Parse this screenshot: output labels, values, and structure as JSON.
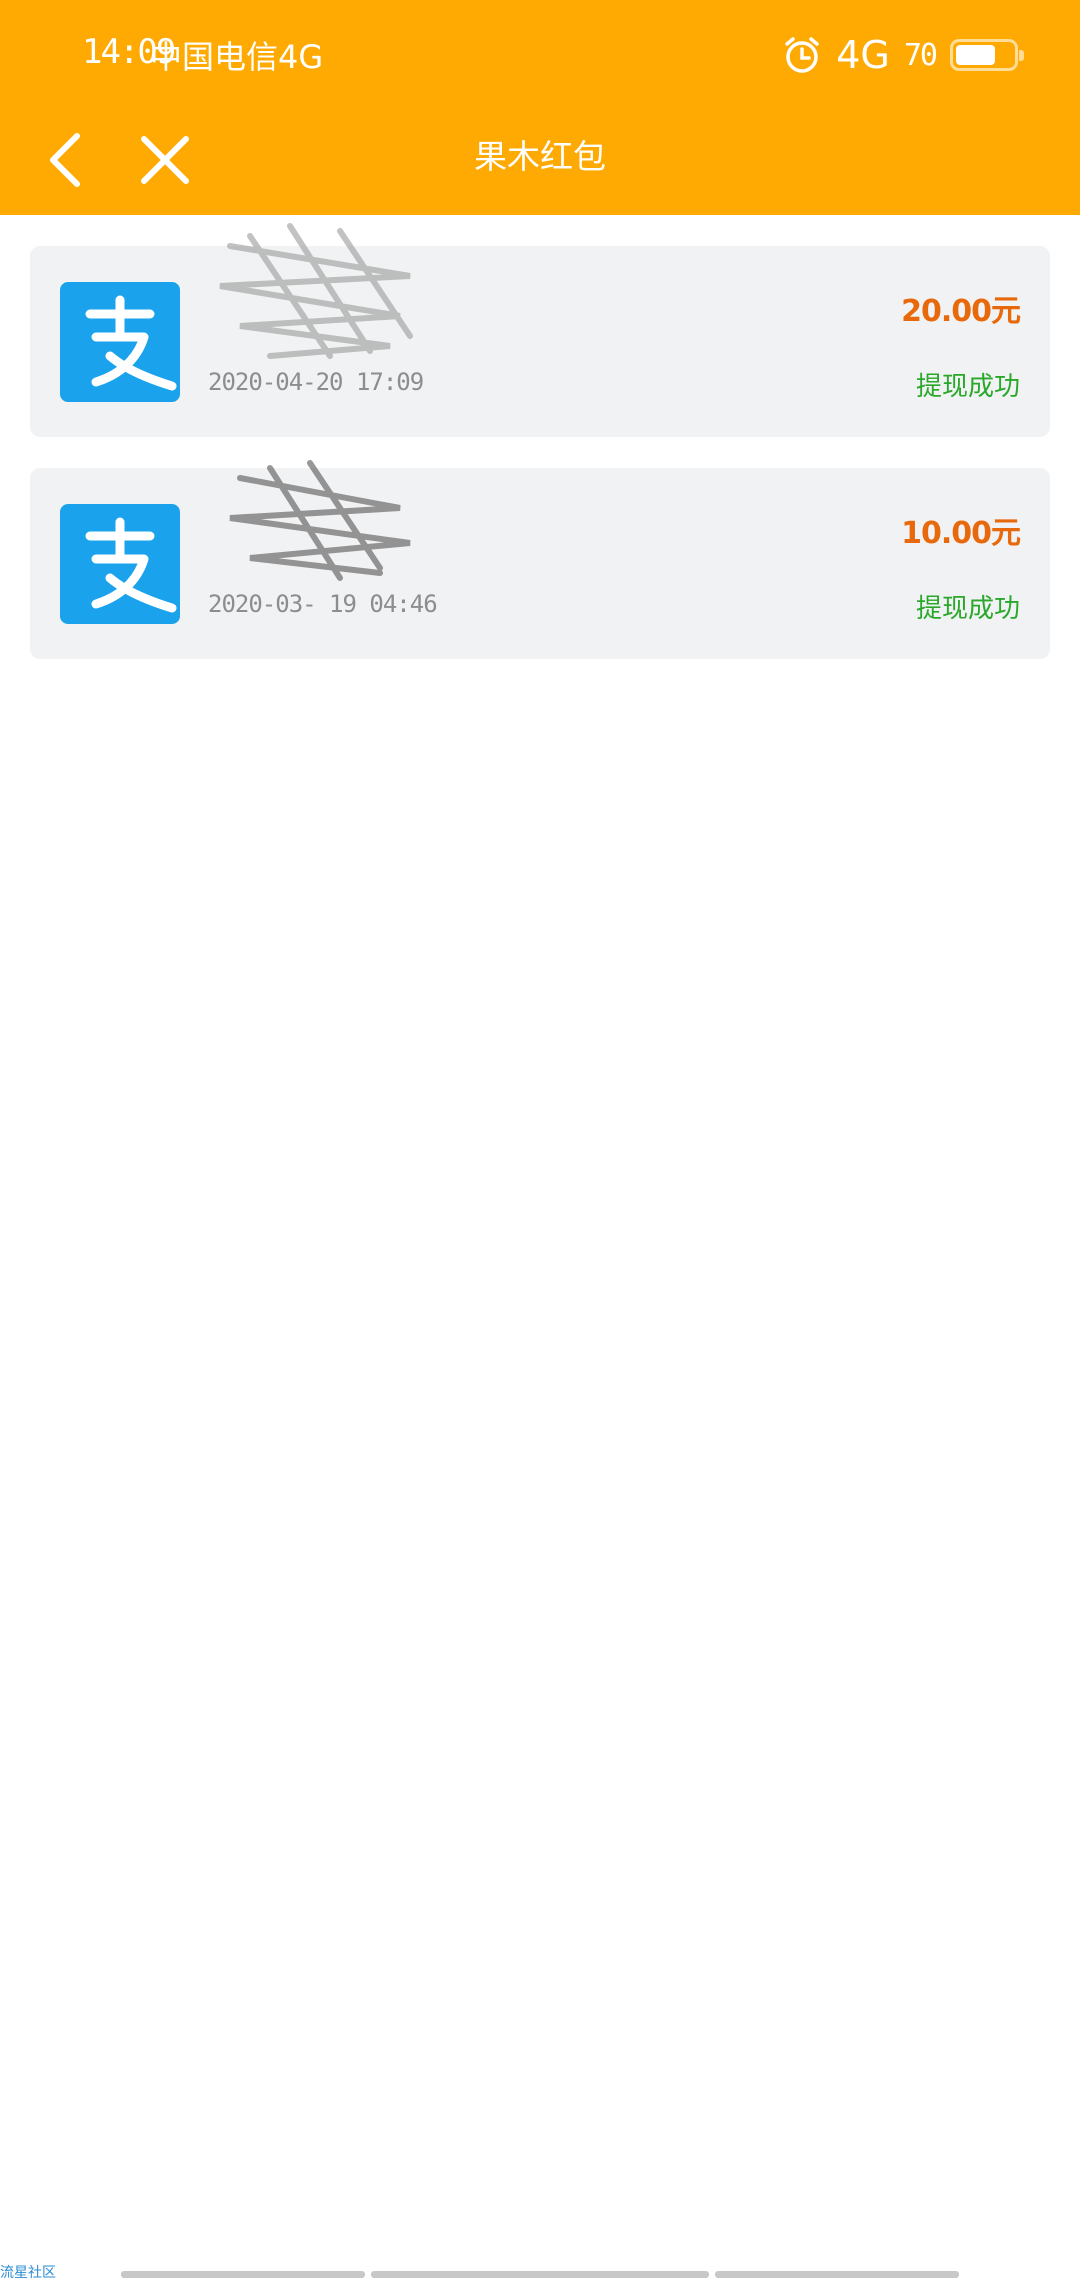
{
  "status_bar": {
    "time": "14:09",
    "carrier": "中国电信4G",
    "network": "4G",
    "battery_level": "70",
    "battery_fraction": 0.7,
    "icons": [
      "alarm-icon",
      "battery-icon"
    ]
  },
  "nav": {
    "title": "果木红包",
    "icons": [
      "chevron-left-icon",
      "close-icon"
    ]
  },
  "records": [
    {
      "date": "2020-04-20  17:09",
      "amount": "20.00元",
      "status": "提现成功",
      "logo": "alipay-logo-icon"
    },
    {
      "date": "2020-03- 19 04:46",
      "amount": "10.00元",
      "status": "提现成功",
      "logo": "alipay-logo-icon"
    }
  ],
  "watermark": "流星社区",
  "colors": {
    "header": "#FEAA02",
    "card_bg": "#F1F2F4",
    "amount": "#E8690C",
    "status": "#29A829",
    "alipay_blue": "#1AA3EC"
  }
}
